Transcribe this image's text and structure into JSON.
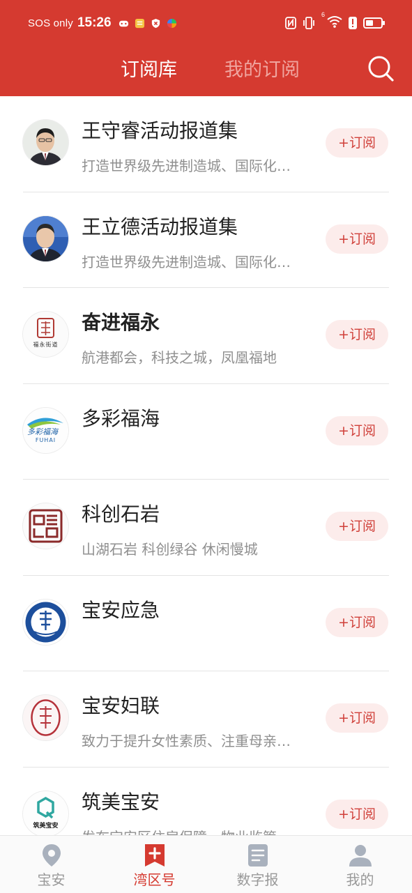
{
  "status_bar": {
    "carrier": "SOS only",
    "time": "15:26",
    "signal_badge": "6"
  },
  "tabs": [
    {
      "label": "订阅库",
      "active": true
    },
    {
      "label": "我的订阅",
      "active": false
    }
  ],
  "subscribe_label": "+订阅",
  "items": [
    {
      "title": "王守睿活动报道集",
      "desc": "打造世界级先进制造城、国际化…",
      "avatar": "portrait-avatar"
    },
    {
      "title": "王立德活动报道集",
      "desc": "打造世界级先进制造城、国际化…",
      "avatar": "portrait-avatar"
    },
    {
      "title": "奋进福永",
      "desc": "航港都会，科技之城，凤凰福地",
      "avatar": "fuyong-seal-logo"
    },
    {
      "title": "多彩福海",
      "desc": "",
      "avatar": "fuhai-logo",
      "logo_text": "多彩福海",
      "logo_sub": "FUHAI"
    },
    {
      "title": "科创石岩",
      "desc": "山湖石岩  科创绿谷  休闲慢城",
      "avatar": "shiyan-seal-logo"
    },
    {
      "title": "宝安应急",
      "desc": "",
      "avatar": "emergency-badge-logo"
    },
    {
      "title": "宝安妇联",
      "desc": "致力于提升女性素质、注重母亲…",
      "avatar": "women-federation-logo"
    },
    {
      "title": "筑美宝安",
      "desc": "发布宝安区住房保障、物业监管…",
      "avatar": "zhumei-logo",
      "logo_text": "筑美宝安"
    }
  ],
  "fuyong_logo_text": "福永街道",
  "bottom_nav": [
    {
      "label": "宝安",
      "icon": "location-pin-icon",
      "active": false
    },
    {
      "label": "湾区号",
      "icon": "bookmark-plus-icon",
      "active": true
    },
    {
      "label": "数字报",
      "icon": "document-icon",
      "active": false
    },
    {
      "label": "我的",
      "icon": "person-icon",
      "active": false
    }
  ],
  "colors": {
    "brand_red": "#d53a30",
    "subscribe_bg": "#fceceb",
    "subscribe_text": "#d0403a",
    "inactive_tab": "#f0a49e"
  }
}
